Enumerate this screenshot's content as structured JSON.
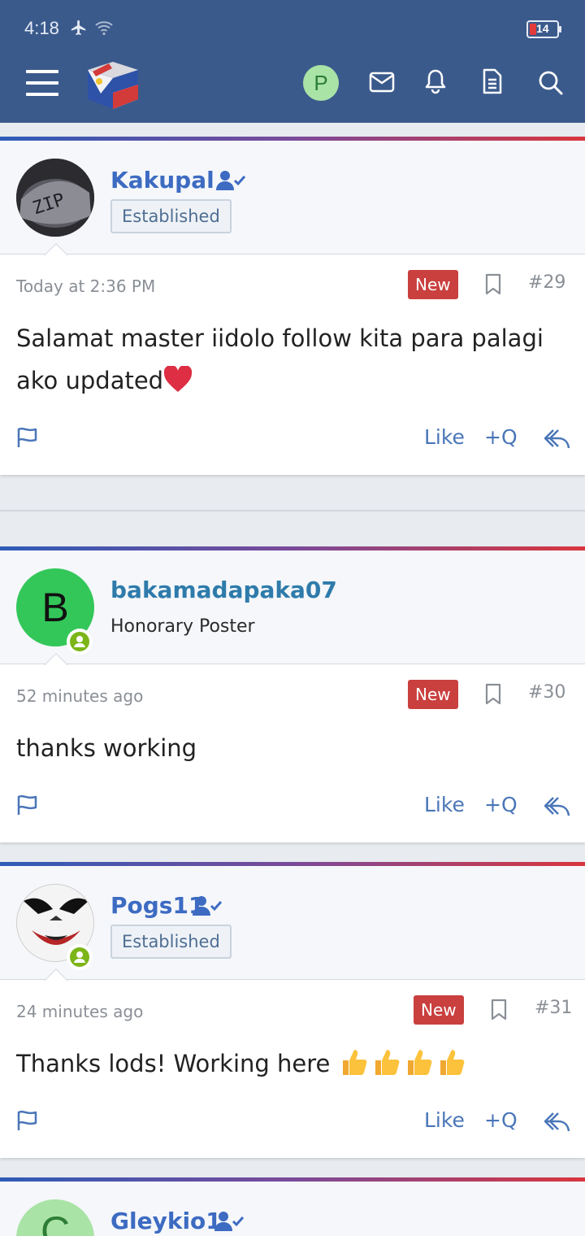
{
  "status_bar": {
    "time": "4:18",
    "battery": "14"
  },
  "nav": {
    "avatar_letter": "P"
  },
  "posts": [
    {
      "username": "Kakupal",
      "role": "Established",
      "time": "Today at 2:36 PM",
      "new_label": "New",
      "number": "#29",
      "text": "Salamat master iidolo follow kita para palagi ako updated",
      "like": "Like",
      "quote": "+Q"
    },
    {
      "username": "bakamadapaka07",
      "avatar_letter": "B",
      "role": "Honorary Poster",
      "time": "52 minutes ago",
      "new_label": "New",
      "number": "#30",
      "text": "thanks working",
      "like": "Like",
      "quote": "+Q"
    },
    {
      "username": "Pogs11",
      "role": "Established",
      "time": "24 minutes ago",
      "new_label": "New",
      "number": "#31",
      "text": "Thanks lods! Working here",
      "like": "Like",
      "quote": "+Q"
    },
    {
      "username": "Gleykio1",
      "avatar_letter": "C"
    }
  ],
  "colors": {
    "header": "#3b5a8c",
    "accent": "#3d6bc2",
    "new_badge": "#c9403f",
    "online": "#7cb518"
  }
}
